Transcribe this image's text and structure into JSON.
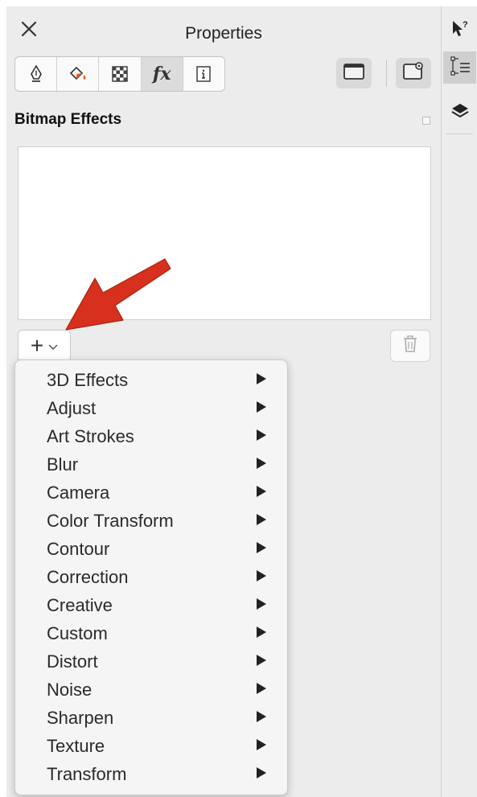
{
  "panel": {
    "title": "Properties",
    "close_icon": "close-icon",
    "tabs": [
      {
        "name": "outline",
        "icon": "pen-nib-icon"
      },
      {
        "name": "fill",
        "icon": "paint-bucket-icon"
      },
      {
        "name": "transparency",
        "icon": "checkerboard-icon"
      },
      {
        "name": "effects",
        "icon": "fx-icon",
        "glyph": "fx",
        "active": true
      },
      {
        "name": "summary",
        "icon": "info-icon"
      }
    ],
    "view_buttons": [
      {
        "name": "docked-view",
        "icon": "window-frame-icon"
      },
      {
        "name": "floating-view",
        "icon": "window-eye-icon"
      }
    ]
  },
  "bitmap_effects": {
    "title": "Bitmap Effects",
    "add_button": {
      "plus": "+",
      "chevron": "⌄"
    },
    "delete_icon": "trash-icon"
  },
  "menu": {
    "items": [
      {
        "label": "3D Effects"
      },
      {
        "label": "Adjust"
      },
      {
        "label": "Art Strokes"
      },
      {
        "label": "Blur"
      },
      {
        "label": "Camera"
      },
      {
        "label": "Color Transform"
      },
      {
        "label": "Contour"
      },
      {
        "label": "Correction"
      },
      {
        "label": "Creative"
      },
      {
        "label": "Custom"
      },
      {
        "label": "Distort"
      },
      {
        "label": "Noise"
      },
      {
        "label": "Sharpen"
      },
      {
        "label": "Texture"
      },
      {
        "label": "Transform"
      }
    ]
  },
  "side_strip": {
    "buttons": [
      {
        "name": "hints",
        "icon": "pointer-help-icon"
      },
      {
        "name": "object-properties",
        "icon": "properties-list-icon",
        "active": true
      },
      {
        "name": "layers",
        "icon": "layers-icon"
      }
    ]
  },
  "colors": {
    "panel_bg": "#ececec",
    "annotation_arrow": "#d8301e"
  }
}
